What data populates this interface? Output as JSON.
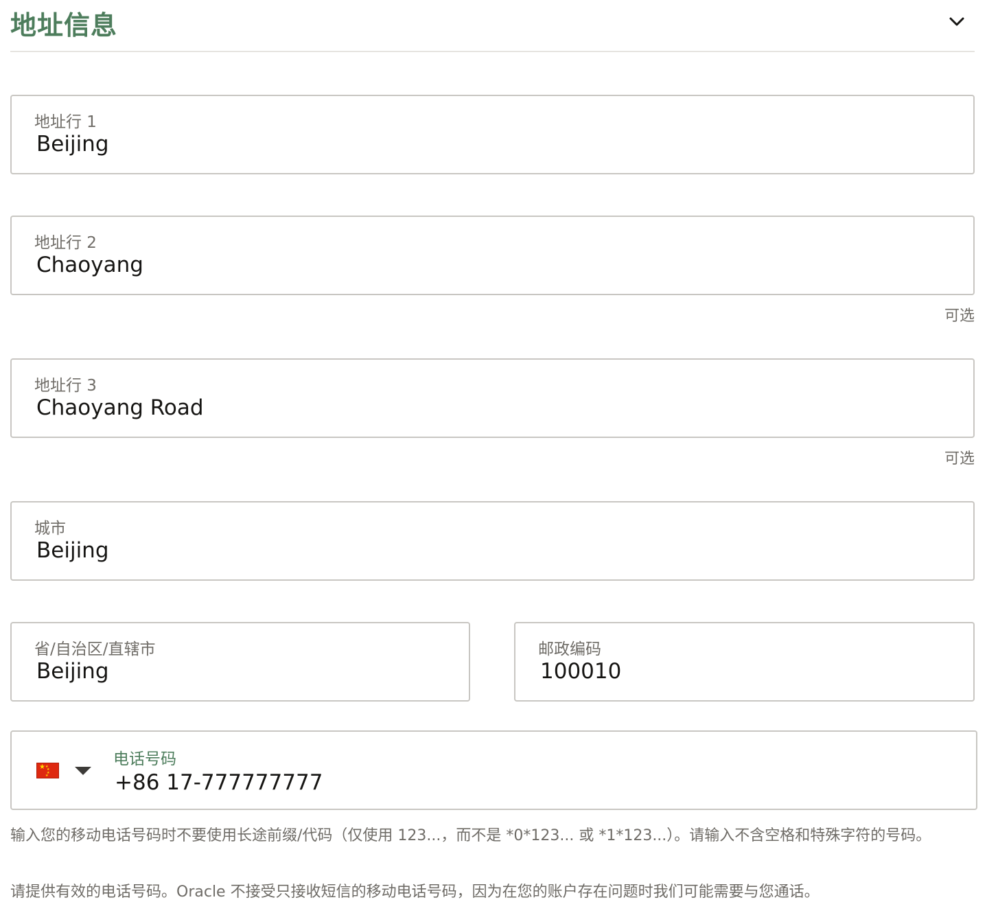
{
  "section": {
    "title": "地址信息",
    "collapse_icon": "chevron-down-icon"
  },
  "fields": {
    "address1": {
      "label": "地址行 1",
      "value": "Beijing"
    },
    "address2": {
      "label": "地址行 2",
      "value": "Chaoyang",
      "optional": "可选"
    },
    "address3": {
      "label": "地址行 3",
      "value": "Chaoyang Road",
      "optional": "可选"
    },
    "city": {
      "label": "城市",
      "value": "Beijing"
    },
    "province": {
      "label": "省/自治区/直辖市",
      "value": "Beijing"
    },
    "postal": {
      "label": "邮政编码",
      "value": "100010"
    },
    "phone": {
      "label": "电话号码",
      "value": "+86 17-777777777",
      "country_flag_icon": "china-flag-icon"
    }
  },
  "help": {
    "line1": "输入您的移动电话号码时不要使用长途前缀/代码（仅使用 123...，而不是 *0*123... 或 *1*123...）。请输入不含空格和特殊字符的号码。",
    "line2": "请提供有效的电话号码。Oracle 不接受只接收短信的移动电话号码，因为在您的账户存在问题时我们可能需要与您通话。"
  },
  "colors": {
    "title_green": "#4d7d5c",
    "border": "#c8c6c2",
    "label_gray": "#6f6c67",
    "text": "#161513"
  }
}
